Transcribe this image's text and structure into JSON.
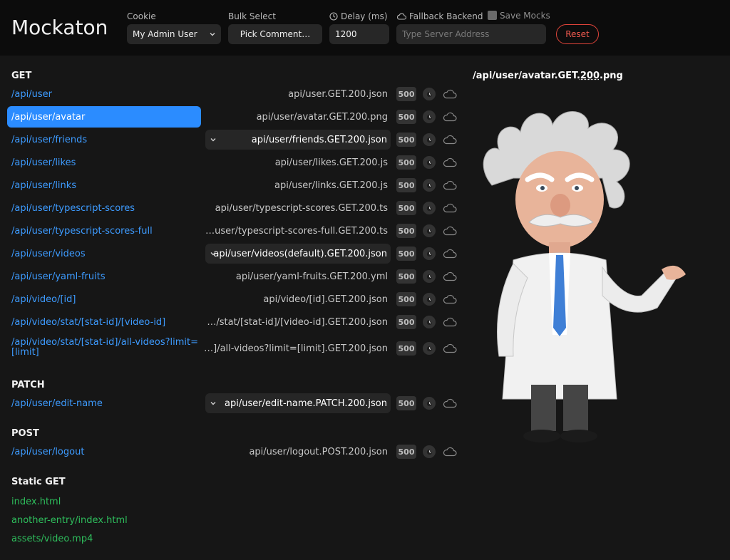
{
  "app": {
    "title": "Mockaton"
  },
  "header": {
    "cookie": {
      "label": "Cookie",
      "value": "My Admin User"
    },
    "bulk_select": {
      "label": "Bulk Select",
      "value": "Pick Comment…"
    },
    "delay": {
      "label": "Delay (ms)",
      "value": "1200"
    },
    "fallback": {
      "label": "Fallback Backend",
      "placeholder": "Type Server Address"
    },
    "save_mocks": {
      "label": "Save Mocks",
      "checked": false
    },
    "reset_label": "Reset"
  },
  "sections": {
    "get": "GET",
    "patch": "PATCH",
    "post": "POST",
    "static": "Static GET"
  },
  "routes": [
    {
      "route": "/api/user",
      "mock": "api/user.GET.200.json",
      "kind": "text",
      "status": "500"
    },
    {
      "route": "/api/user/avatar",
      "mock": "api/user/avatar.GET.200.png",
      "kind": "text",
      "status": "500",
      "selected": true
    },
    {
      "route": "/api/user/friends",
      "mock": "api/user/friends.GET.200.json",
      "kind": "select",
      "status": "500"
    },
    {
      "route": "/api/user/likes",
      "mock": "api/user/likes.GET.200.js",
      "kind": "text",
      "status": "500"
    },
    {
      "route": "/api/user/links",
      "mock": "api/user/links.GET.200.js",
      "kind": "text",
      "status": "500"
    },
    {
      "route": "/api/user/typescript-scores",
      "mock": "api/user/typescript-scores.GET.200.ts",
      "kind": "text",
      "status": "500"
    },
    {
      "route": "/api/user/typescript-scores-full",
      "mock": "…user/typescript-scores-full.GET.200.ts",
      "kind": "text",
      "status": "500"
    },
    {
      "route": "/api/user/videos",
      "mock": "api/user/videos(default).GET.200.json",
      "kind": "select",
      "status": "500"
    },
    {
      "route": "/api/user/yaml-fruits",
      "mock": "api/user/yaml-fruits.GET.200.yml",
      "kind": "text",
      "status": "500"
    },
    {
      "route": "/api/video/[id]",
      "mock": "api/video/[id].GET.200.json",
      "kind": "text",
      "status": "500"
    },
    {
      "route": "/api/video/stat/[stat-id]/[video-id]",
      "mock": "…/stat/[stat-id]/[video-id].GET.200.json",
      "kind": "text",
      "status": "500"
    },
    {
      "route": "/api/video/stat/[stat-id]/all-videos?limit=[limit]",
      "mock": "…]/all-videos?limit=[limit].GET.200.json",
      "kind": "text",
      "status": "500"
    },
    {
      "route": "/api/user/edit-name",
      "mock": "api/user/edit-name.PATCH.200.json",
      "kind": "select",
      "status": "500"
    },
    {
      "route": "/api/user/logout",
      "mock": "api/user/logout.POST.200.json",
      "kind": "text",
      "status": "500"
    }
  ],
  "static_files": [
    "index.html",
    "another-entry/index.html",
    "assets/video.mp4"
  ],
  "preview": {
    "title_prefix": "/api/user/avatar.GET.",
    "title_status": "200",
    "title_suffix": ".png"
  },
  "colors": {
    "accent": "#2b8cff",
    "link": "#3d9bff",
    "static_link": "#2ebd5c",
    "reset": "#f05a4f"
  }
}
